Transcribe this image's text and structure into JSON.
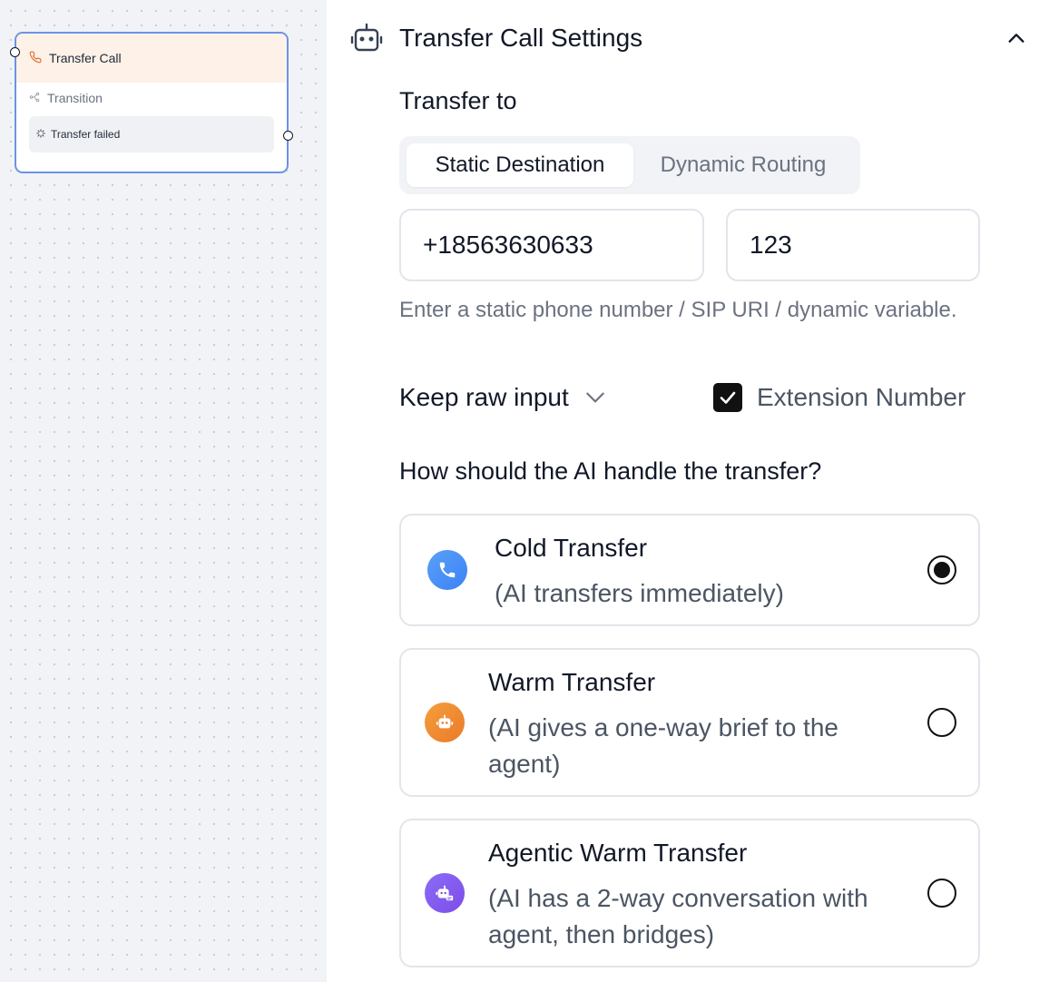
{
  "canvas": {
    "node": {
      "title": "Transfer Call",
      "transition_label": "Transition",
      "failed_label": "Transfer failed"
    }
  },
  "panel": {
    "title": "Transfer Call Settings",
    "transfer_to_label": "Transfer to",
    "tabs": [
      {
        "label": "Static Destination",
        "active": true
      },
      {
        "label": "Dynamic Routing",
        "active": false
      }
    ],
    "phone_value": "+18563630633",
    "extension_value": "123",
    "hint": "Enter a static phone number / SIP URI / dynamic variable.",
    "format_select": "Keep raw input",
    "extension_checkbox": {
      "label": "Extension Number",
      "checked": true
    },
    "question": "How should the AI handle the transfer?",
    "options": [
      {
        "title": "Cold Transfer",
        "desc": "(AI transfers immediately)",
        "selected": true,
        "icon": "phone-icon",
        "color": "#3b82f6"
      },
      {
        "title": "Warm Transfer",
        "desc": "(AI gives a one-way brief to the agent)",
        "selected": false,
        "icon": "robot-icon",
        "color": "#ea7a2a"
      },
      {
        "title": "Agentic Warm Transfer",
        "desc": "(AI has a 2-way conversation with agent, then bridges)",
        "selected": false,
        "icon": "robot-chat-icon",
        "color": "#7c4de8"
      }
    ]
  }
}
